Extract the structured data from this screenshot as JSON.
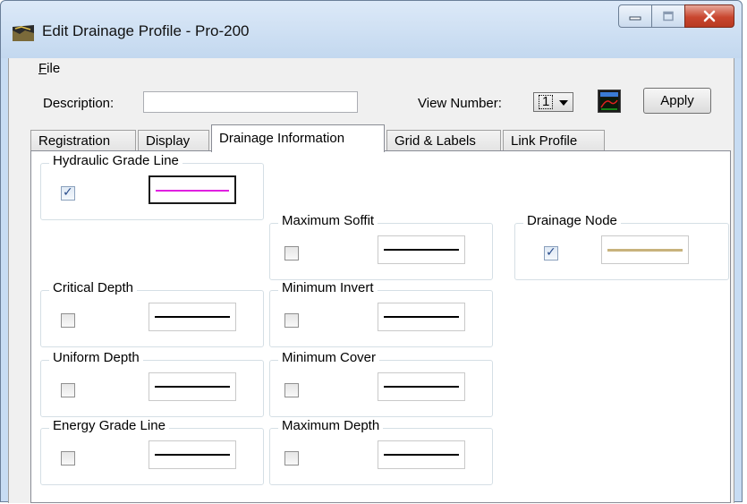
{
  "window": {
    "title": "Edit Drainage Profile - Pro-200",
    "minimize_icon": "minimize-icon",
    "maximize_icon": "maximize-icon",
    "close_icon": "close-icon"
  },
  "menu": {
    "file_first": "F",
    "file_rest": "ile"
  },
  "toolbar": {
    "description_label": "Description:",
    "description_value": "",
    "view_number_label": "View Number:",
    "view_number_value": "1",
    "view_icon": "view-profile-icon",
    "apply_label": "Apply"
  },
  "tabs": [
    {
      "label": "Registration",
      "active": false
    },
    {
      "label": "Display",
      "active": false
    },
    {
      "label": "Drainage Information",
      "active": true
    },
    {
      "label": "Grid & Labels",
      "active": false
    },
    {
      "label": "Link Profile",
      "active": false
    }
  ],
  "groups": {
    "hydraulic_grade_line": {
      "label": "Hydraulic Grade Line",
      "checked": true,
      "line_color": "#e020e0"
    },
    "critical_depth": {
      "label": "Critical Depth",
      "checked": false,
      "line_color": "#000000"
    },
    "uniform_depth": {
      "label": "Uniform Depth",
      "checked": false,
      "line_color": "#000000"
    },
    "energy_grade_line": {
      "label": "Energy Grade Line",
      "checked": false,
      "line_color": "#000000"
    },
    "maximum_soffit": {
      "label": "Maximum Soffit",
      "checked": false,
      "line_color": "#000000"
    },
    "minimum_invert": {
      "label": "Minimum Invert",
      "checked": false,
      "line_color": "#000000"
    },
    "minimum_cover": {
      "label": "Minimum Cover",
      "checked": false,
      "line_color": "#000000"
    },
    "maximum_depth": {
      "label": "Maximum Depth",
      "checked": false,
      "line_color": "#000000"
    },
    "drainage_node": {
      "label": "Drainage Node",
      "checked": true,
      "line_color": "#c8b27c"
    }
  }
}
